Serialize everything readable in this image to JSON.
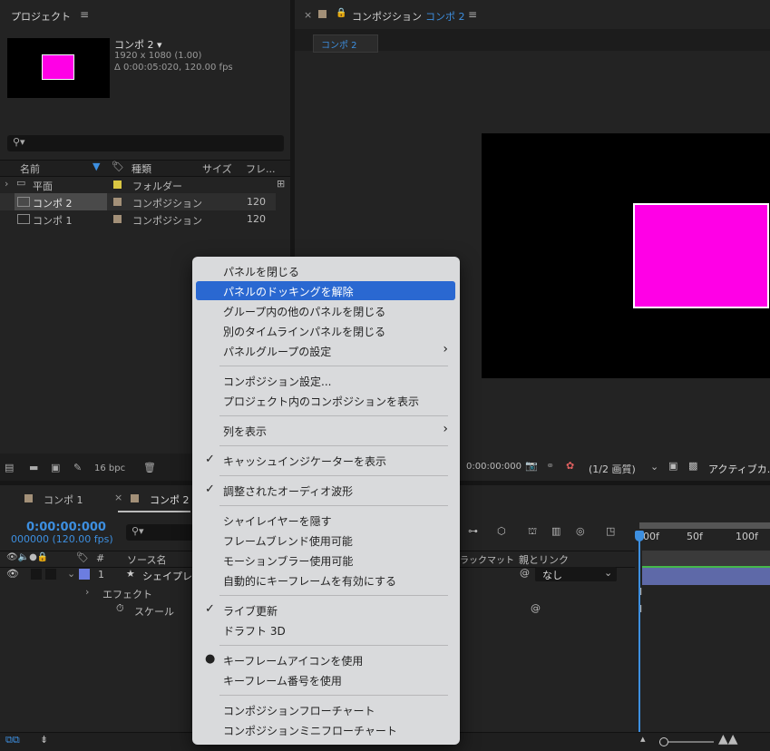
{
  "project": {
    "title": "プロジェクト",
    "comp_name": "コンポ 2 ▾",
    "comp_size": "1920 x 1080 (1.00)",
    "comp_duration": "Δ 0:00:05:020, 120.00 fps",
    "search_placeholder": "",
    "columns": {
      "name": "名前",
      "type": "種類",
      "size": "サイズ",
      "frame": "フレ..."
    },
    "items": [
      {
        "name": "平面",
        "type": "フォルダー",
        "size": "",
        "frame": ""
      },
      {
        "name": "コンポ 2",
        "type": "コンポジション",
        "size": "",
        "frame": "120"
      },
      {
        "name": "コンポ 1",
        "type": "コンポジション",
        "size": "",
        "frame": "120"
      }
    ],
    "bpc": "16 bpc"
  },
  "composition": {
    "title_prefix": "コンポジション",
    "title_comp": "コンポ 2",
    "tab": "コンポ 2",
    "timecode": "0:00:00:000",
    "resolution": "(1/2 画質)",
    "camera": "アクティブカ..."
  },
  "timeline": {
    "tabs": [
      "コンポ 1",
      "コンポ 2"
    ],
    "timecode": "0:00:00:000",
    "frames": "000000 (120.00 fps)",
    "col_source": "ソース名",
    "col_num": "#",
    "col_matte": "ラックマット",
    "col_parent": "親とリンク",
    "layer_num": "1",
    "layer_name": "シェイプレイ",
    "parent_value": "なし",
    "effects": "エフェクト",
    "scale": "スケール",
    "ruler": [
      "00f",
      "50f",
      "100f"
    ]
  },
  "context_menu": {
    "groups": [
      [
        {
          "label": "パネルを閉じる",
          "check": "",
          "submenu": false,
          "highlight": false
        },
        {
          "label": "パネルのドッキングを解除",
          "check": "",
          "submenu": false,
          "highlight": true
        },
        {
          "label": "グループ内の他のパネルを閉じる",
          "check": "",
          "submenu": false,
          "highlight": false
        },
        {
          "label": "別のタイムラインパネルを閉じる",
          "check": "",
          "submenu": false,
          "highlight": false
        },
        {
          "label": "パネルグループの設定",
          "check": "",
          "submenu": true,
          "highlight": false
        }
      ],
      [
        {
          "label": "コンポジション設定...",
          "check": "",
          "submenu": false,
          "highlight": false
        },
        {
          "label": "プロジェクト内のコンポジションを表示",
          "check": "",
          "submenu": false,
          "highlight": false
        }
      ],
      [
        {
          "label": "列を表示",
          "check": "",
          "submenu": true,
          "highlight": false
        }
      ],
      [
        {
          "label": "キャッシュインジケーターを表示",
          "check": "✓",
          "submenu": false,
          "highlight": false
        }
      ],
      [
        {
          "label": "調整されたオーディオ波形",
          "check": "✓",
          "submenu": false,
          "highlight": false
        }
      ],
      [
        {
          "label": "シャイレイヤーを隠す",
          "check": "",
          "submenu": false,
          "highlight": false
        },
        {
          "label": "フレームブレンド使用可能",
          "check": "",
          "submenu": false,
          "highlight": false
        },
        {
          "label": "モーションブラー使用可能",
          "check": "",
          "submenu": false,
          "highlight": false
        },
        {
          "label": "自動的にキーフレームを有効にする",
          "check": "",
          "submenu": false,
          "highlight": false
        }
      ],
      [
        {
          "label": "ライブ更新",
          "check": "✓",
          "submenu": false,
          "highlight": false
        },
        {
          "label": "ドラフト 3D",
          "check": "",
          "submenu": false,
          "highlight": false
        }
      ],
      [
        {
          "label": "キーフレームアイコンを使用",
          "check": "●",
          "submenu": false,
          "highlight": false
        },
        {
          "label": "キーフレーム番号を使用",
          "check": "",
          "submenu": false,
          "highlight": false
        }
      ],
      [
        {
          "label": "コンポジションフローチャート",
          "check": "",
          "submenu": false,
          "highlight": false
        },
        {
          "label": "コンポジションミニフローチャート",
          "check": "",
          "submenu": false,
          "highlight": false
        }
      ]
    ]
  },
  "colors": {
    "accent": "#2a68d1",
    "magenta": "#ff00e6",
    "folder": "#d9c642",
    "comp_label": "#a39078",
    "layer_label": "#6c7de0",
    "timecode_blue": "#3d8fe0"
  }
}
